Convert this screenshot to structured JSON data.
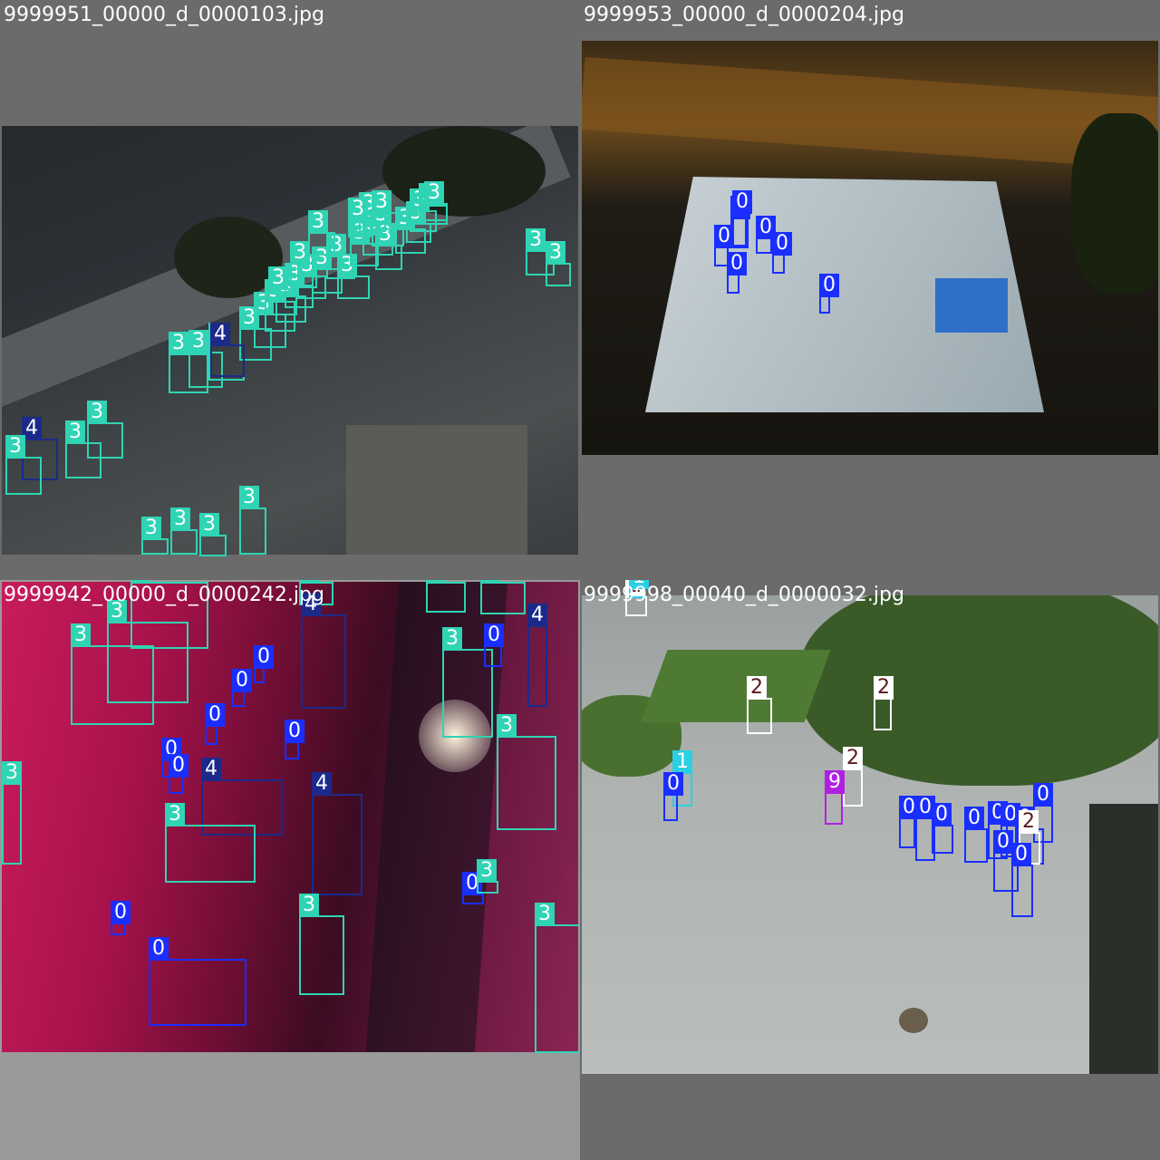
{
  "colors": {
    "class_0": "#1a2eff",
    "class_1": "#2ad0e4",
    "class_2": "#ffffff",
    "class_3": "#2fd4b4",
    "class_4": "#1b2a8a",
    "class_9": "#b020e0"
  },
  "tiles": [
    {
      "filename": "9999951_00000_d_0000103.jpg",
      "scene": "night aerial view of a parking lot beside a highway",
      "labels": [
        "3",
        "3",
        "3",
        "3",
        "3",
        "3",
        "3",
        "3",
        "3",
        "3",
        "3",
        "3",
        "3",
        "3",
        "3",
        "3",
        "3",
        "3",
        "3",
        "3",
        "3",
        "3",
        "3",
        "3",
        "3",
        "3",
        "4",
        "3",
        "3",
        "4",
        "3",
        "3",
        "3",
        "3",
        "3",
        "3",
        "3",
        "3"
      ]
    },
    {
      "filename": "9999953_00000_d_0000204.jpg",
      "scene": "night aerial view of a rooftop basketball court",
      "labels": [
        "0",
        "0",
        "0",
        "0",
        "0",
        "0",
        "0"
      ]
    },
    {
      "filename": "9999942_00000_d_0000242.jpg",
      "scene": "night aerial view of a street lit with pink and red light",
      "labels": [
        "3",
        "3",
        "3",
        "3",
        "3",
        "3",
        "4",
        "3",
        "0",
        "0",
        "0",
        "0",
        "0",
        "0",
        "0",
        "3",
        "3",
        "4",
        "3",
        "4",
        "3",
        "0",
        "0",
        "0",
        "3",
        "3",
        "4"
      ]
    },
    {
      "filename": "9999998_00040_d_0000032.jpg",
      "scene": "daytime aerial view of a paved plaza with trees",
      "labels": [
        "2",
        "1",
        "2",
        "2",
        "2",
        "1",
        "0",
        "9",
        "0",
        "0",
        "0",
        "0",
        "0",
        "0",
        "0",
        "0",
        "2",
        "0",
        "0"
      ]
    }
  ]
}
